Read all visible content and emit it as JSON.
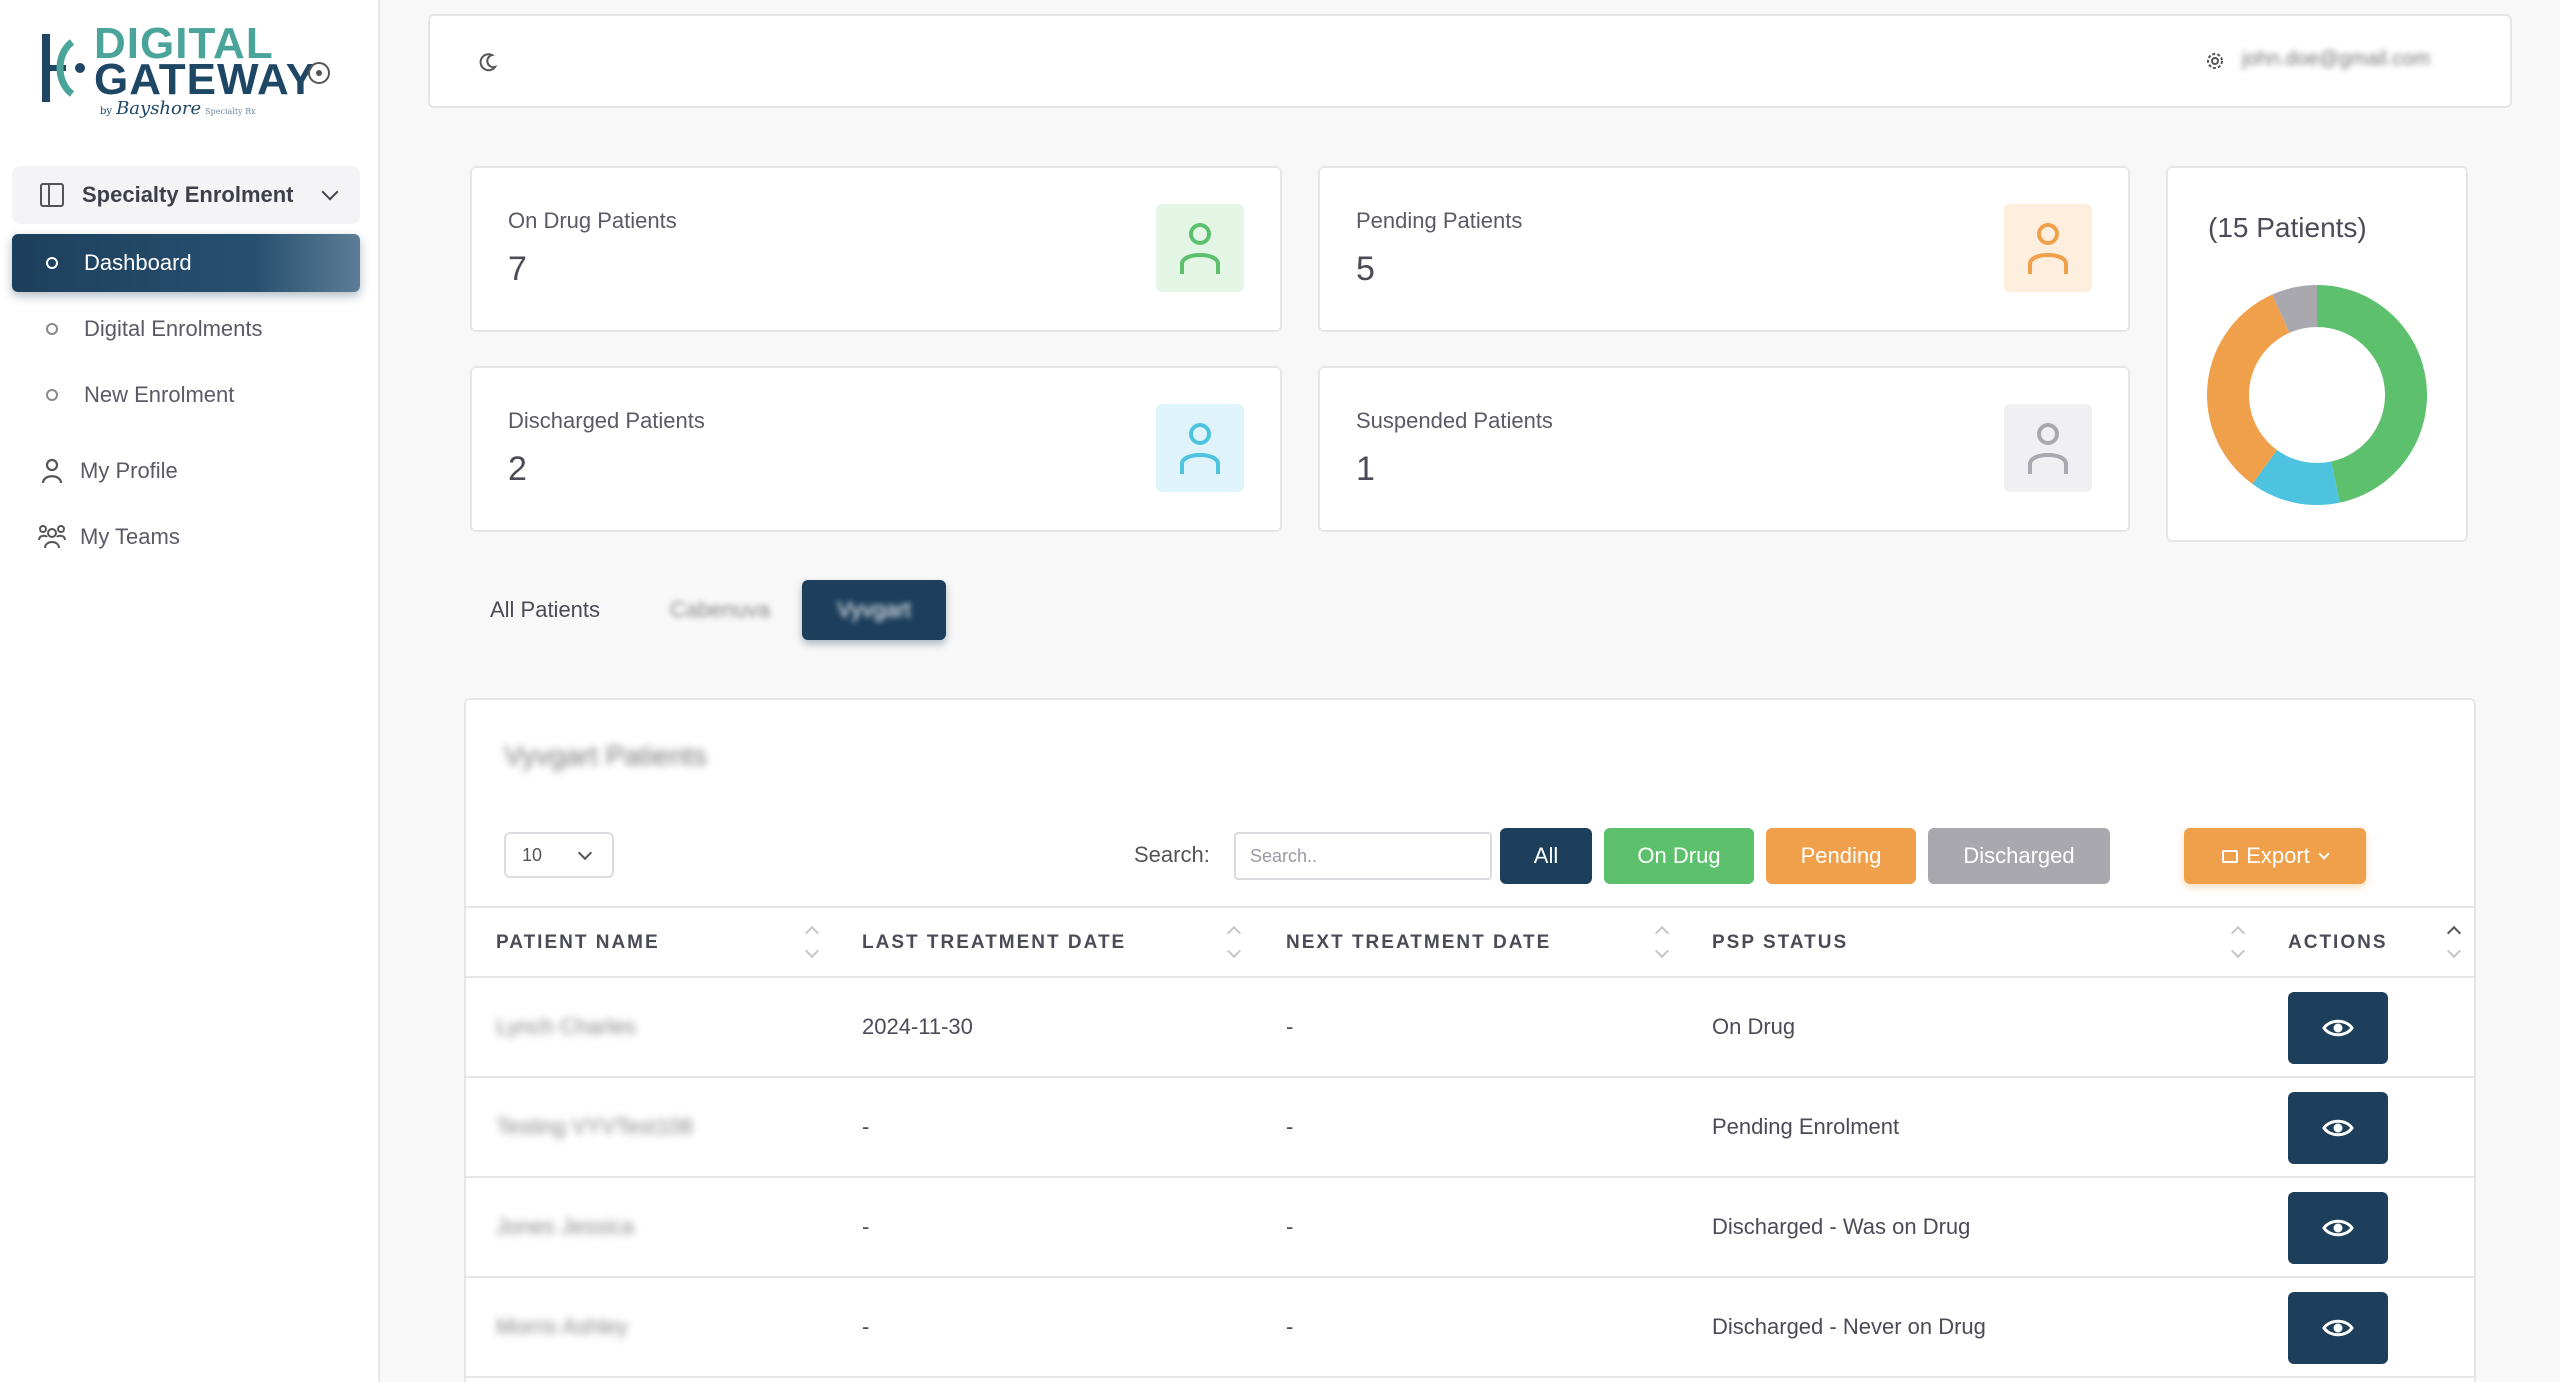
{
  "brand": {
    "line1": "DIGITAL",
    "line2": "GATEWAY",
    "by": "by",
    "maker": "Bayshore",
    "maker_sub": "Specialty Rx"
  },
  "sidebar": {
    "section_label": "Specialty Enrolment",
    "items": [
      {
        "label": "Dashboard",
        "active": true
      },
      {
        "label": "Digital Enrolments"
      },
      {
        "label": "New Enrolment"
      }
    ],
    "links": [
      {
        "label": "My Profile",
        "icon": "user-icon"
      },
      {
        "label": "My Teams",
        "icon": "team-icon"
      }
    ]
  },
  "header": {
    "theme_icon": "moon-icon",
    "settings_icon": "gear-icon",
    "user_email": "john.doe@gmail.com"
  },
  "stats": [
    {
      "label": "On Drug Patients",
      "value": "7",
      "color": "#5cc06c",
      "bg": "#e3f6e6"
    },
    {
      "label": "Pending Patients",
      "value": "5",
      "color": "#f0a04b",
      "bg": "#fdeedd"
    },
    {
      "label": "Discharged Patients",
      "value": "2",
      "color": "#4ec3e0",
      "bg": "#dff4fa"
    },
    {
      "label": "Suspended Patients",
      "value": "1",
      "color": "#a8a8ae",
      "bg": "#f0f0f2"
    }
  ],
  "chart": {
    "title": "(15 Patients)"
  },
  "chart_data": {
    "type": "pie",
    "title": "(15 Patients)",
    "categories": [
      "On Drug",
      "Discharged",
      "Pending",
      "Suspended"
    ],
    "values": [
      7,
      2,
      5,
      1
    ],
    "colors": [
      "#5cc06c",
      "#4ec3e0",
      "#f0a04b",
      "#a8a8ae"
    ],
    "donut": true,
    "legend": "none"
  },
  "tabs": [
    {
      "label": "All Patients"
    },
    {
      "label": "Cabenuva"
    },
    {
      "label": "Vyvgart"
    }
  ],
  "table": {
    "title": "Vyvgart Patients",
    "page_length": "10",
    "search_label": "Search:",
    "search_placeholder": "Search..",
    "filters": {
      "all": "All",
      "on_drug": "On Drug",
      "pending": "Pending",
      "discharged": "Discharged"
    },
    "export_label": "Export",
    "columns": [
      "PATIENT NAME",
      "LAST TREATMENT DATE",
      "NEXT TREATMENT DATE",
      "PSP STATUS",
      "ACTIONS"
    ],
    "rows": [
      {
        "name": "Lynch Charles",
        "last": "2024-11-30",
        "next": "-",
        "status": "On Drug"
      },
      {
        "name": "Testing VYVTest108",
        "last": "-",
        "next": "-",
        "status": "Pending Enrolment"
      },
      {
        "name": "Jones Jessica",
        "last": "-",
        "next": "-",
        "status": "Discharged - Was on Drug"
      },
      {
        "name": "Morris Ashley",
        "last": "-",
        "next": "-",
        "status": "Discharged - Never on Drug"
      }
    ]
  }
}
